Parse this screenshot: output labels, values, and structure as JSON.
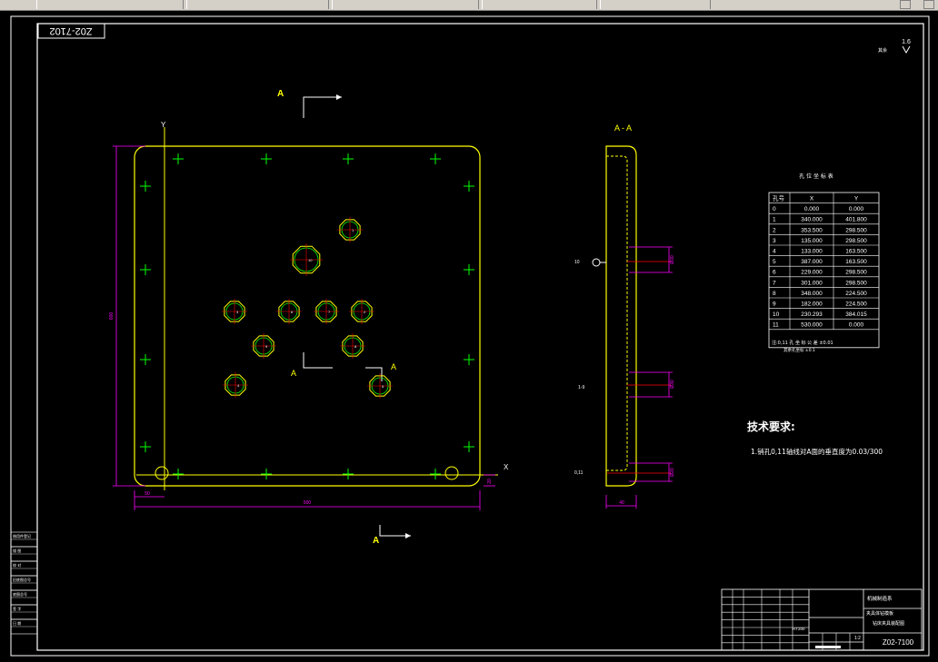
{
  "drawing": {
    "number_top": "Z02-7102",
    "number_bottom": "Z02-7100",
    "roughness_value": "1.6",
    "roughness_note": "其余",
    "section_mark": "A",
    "section_title": "A - A",
    "axis_x": "X",
    "axis_y": "Y",
    "dims": {
      "height_left": "600",
      "width_bottom": "500",
      "offset_left": "50",
      "offset_right": "20",
      "thickness": "40",
      "side_label_top": "10",
      "side_label_mid": "1-9",
      "side_label_bot": "0,11",
      "hole_dim_1": "Ø30",
      "hole_dim_2": "Ø30",
      "hole_dim_3": "Ø20"
    },
    "tech_title": "技术要求:",
    "tech_note": "1.销孔0,11轴线对A面的垂直度为0.03/300",
    "holes": [
      {
        "label": "1"
      },
      {
        "label": "2"
      },
      {
        "label": "3"
      },
      {
        "label": "4"
      },
      {
        "label": "5"
      },
      {
        "label": "6"
      },
      {
        "label": "7"
      },
      {
        "label": "8"
      },
      {
        "label": "9"
      },
      {
        "label": "10"
      }
    ]
  },
  "coord_table": {
    "title": "孔 位 坐 标 表",
    "headers": [
      "孔号",
      "X",
      "Y"
    ],
    "rows": [
      [
        "0",
        "0.000",
        "0.000"
      ],
      [
        "1",
        "340.000",
        "401.800"
      ],
      [
        "2",
        "353.500",
        "298.500"
      ],
      [
        "3",
        "135.000",
        "298.500"
      ],
      [
        "4",
        "133.000",
        "163.500"
      ],
      [
        "5",
        "387.000",
        "163.500"
      ],
      [
        "6",
        "229.000",
        "298.500"
      ],
      [
        "7",
        "301.000",
        "298.500"
      ],
      [
        "8",
        "348.000",
        "224.500"
      ],
      [
        "9",
        "182.000",
        "224.500"
      ],
      [
        "10",
        "230.293",
        "384.015"
      ],
      [
        "11",
        "530.000",
        "0.000"
      ]
    ],
    "footnote_1": "注:0,11 孔 坐 标 公 差 ±0.01",
    "footnote_2": "其余孔坐标 ±0.1"
  },
  "title_block": {
    "org": "机械制造系",
    "part_name_1": "夹具体钻模板",
    "part_name_2": "钻床夹具装配图",
    "scale": "1:2",
    "material": "HT200",
    "number": "Z02-7100"
  },
  "side_block": {
    "labels": [
      "借用件登记",
      "描 图",
      "校 对",
      "旧底图总号",
      "底图总号",
      "签 字",
      "日 期"
    ]
  }
}
